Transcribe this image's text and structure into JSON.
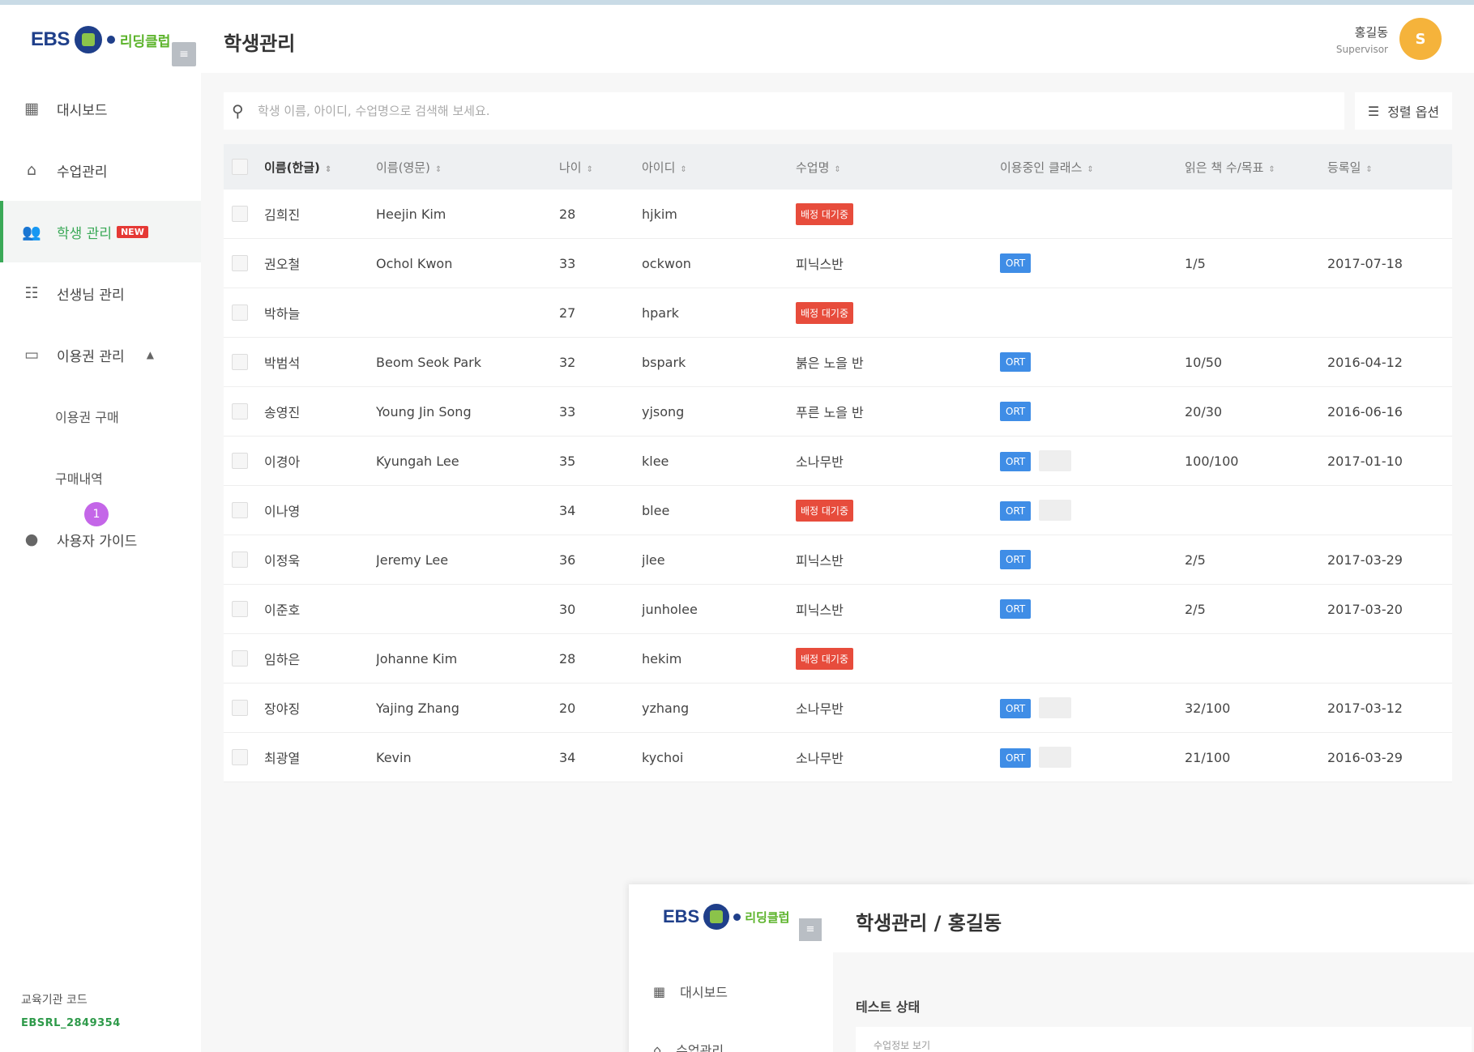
{
  "logo": {
    "ebs": "EBS",
    "brand": "리딩클럽"
  },
  "sidebar": {
    "items": [
      {
        "label": "대시보드"
      },
      {
        "label": "수업관리"
      },
      {
        "label": "학생 관리",
        "badge": "NEW"
      },
      {
        "label": "선생님 관리"
      },
      {
        "label": "이용권 관리"
      },
      {
        "label": "이용권 구매"
      },
      {
        "label": "구매내역"
      },
      {
        "label": "사용자 가이드"
      }
    ],
    "notification_count": "1",
    "school_label": "교육기관 코드",
    "school_code": "EBSRL_2849354"
  },
  "header": {
    "title": "학생관리",
    "user_name": "홍길동",
    "user_role": "Supervisor",
    "avatar_initial": "S"
  },
  "search": {
    "placeholder": "학생 이름, 아이디, 수업명으로 검색해 보세요.",
    "filter_label": "정렬 옵션"
  },
  "table": {
    "headers": {
      "name_kor": "이름(한글)",
      "name_eng": "이름(영문)",
      "age": "나이",
      "id": "아이디",
      "level": "수업명",
      "class": "이용중인 클래스",
      "books": "읽은 책 수/목표",
      "registered": "등록일"
    },
    "rows": [
      {
        "name_kor": "김희진",
        "name_eng": "Heejin Kim",
        "age": "28",
        "id": "hjkim",
        "level": "배정 대기중",
        "level_type": "waiting",
        "class": "",
        "ghost": false,
        "books": "",
        "registered": ""
      },
      {
        "name_kor": "권오철",
        "name_eng": "Ochol Kwon",
        "age": "33",
        "id": "ockwon",
        "level": "피닉스반",
        "level_type": "text",
        "class": "ORT",
        "ghost": false,
        "books": "1/5",
        "registered": "2017-07-18"
      },
      {
        "name_kor": "박하늘",
        "name_eng": "",
        "age": "27",
        "id": "hpark",
        "level": "배정 대기중",
        "level_type": "waiting",
        "class": "",
        "ghost": false,
        "books": "",
        "registered": ""
      },
      {
        "name_kor": "박범석",
        "name_eng": "Beom Seok Park",
        "age": "32",
        "id": "bspark",
        "level": "붉은 노을 반",
        "level_type": "text",
        "class": "ORT",
        "ghost": false,
        "books": "10/50",
        "registered": "2016-04-12"
      },
      {
        "name_kor": "송영진",
        "name_eng": "Young Jin Song",
        "age": "33",
        "id": "yjsong",
        "level": "푸른 노을 반",
        "level_type": "text",
        "class": "ORT",
        "ghost": false,
        "books": "20/30",
        "registered": "2016-06-16"
      },
      {
        "name_kor": "이경아",
        "name_eng": "Kyungah Lee",
        "age": "35",
        "id": "klee",
        "level": "소나무반",
        "level_type": "text",
        "class": "ORT",
        "ghost": true,
        "books": "100/100",
        "registered": "2017-01-10"
      },
      {
        "name_kor": "이나영",
        "name_eng": "",
        "age": "34",
        "id": "blee",
        "level": "배정 대기중",
        "level_type": "waiting",
        "class": "ORT",
        "ghost": true,
        "books": "",
        "registered": ""
      },
      {
        "name_kor": "이정욱",
        "name_eng": "Jeremy Lee",
        "age": "36",
        "id": "jlee",
        "level": "피닉스반",
        "level_type": "text",
        "class": "ORT",
        "ghost": false,
        "books": "2/5",
        "registered": "2017-03-29"
      },
      {
        "name_kor": "이준호",
        "name_eng": "",
        "age": "30",
        "id": "junholee",
        "level": "피닉스반",
        "level_type": "text",
        "class": "ORT",
        "ghost": false,
        "books": "2/5",
        "registered": "2017-03-20"
      },
      {
        "name_kor": "임하은",
        "name_eng": "Johanne Kim",
        "age": "28",
        "id": "hekim",
        "level": "배정 대기중",
        "level_type": "waiting",
        "class": "",
        "ghost": false,
        "books": "",
        "registered": ""
      },
      {
        "name_kor": "장야징",
        "name_eng": "Yajing Zhang",
        "age": "20",
        "id": "yzhang",
        "level": "소나무반",
        "level_type": "text",
        "class": "ORT",
        "ghost": true,
        "books": "32/100",
        "registered": "2017-03-12"
      },
      {
        "name_kor": "최광열",
        "name_eng": "Kevin",
        "age": "34",
        "id": "kychoi",
        "level": "소나무반",
        "level_type": "text",
        "class": "ORT",
        "ghost": true,
        "books": "21/100",
        "registered": "2016-03-29"
      }
    ]
  },
  "overlay": {
    "title": "학생관리 / 홍길동",
    "nav": [
      {
        "label": "대시보드"
      },
      {
        "label": "수업관리"
      }
    ],
    "section_label": "테스트 상태",
    "card_text": "수업정보 보기"
  },
  "colors": {
    "accent_green": "#3aa957",
    "waiting_red": "#e74c3c",
    "ort_blue": "#3f8de6",
    "avatar_orange": "#f5b33b"
  }
}
